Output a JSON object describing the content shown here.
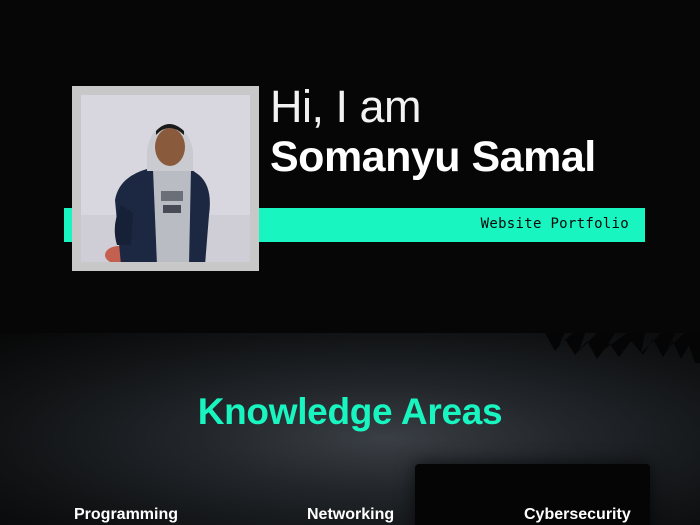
{
  "hero": {
    "greeting": "Hi, I am",
    "name": "Somanyu Samal",
    "tagline": "Website Portfolio"
  },
  "knowledge": {
    "title": "Knowledge Areas",
    "areas": [
      "Programming",
      "Networking",
      "Cybersecurity"
    ]
  },
  "colors": {
    "accent": "#19f5c0",
    "background": "#060606",
    "text": "#ffffff"
  }
}
